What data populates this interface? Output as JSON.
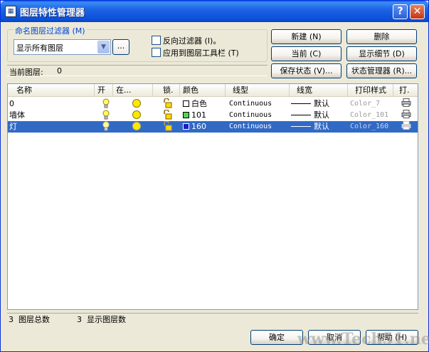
{
  "window": {
    "title": "图层特性管理器",
    "help_glyph": "?",
    "close_glyph": "✕"
  },
  "filter": {
    "group_label": "命名图层过滤器 (M)",
    "selected": "显示所有图层",
    "dots_label": "...",
    "invert_label": "反向过滤器 (I)。",
    "apply_toolbar_label": "应用到图层工具栏 (T)"
  },
  "buttons": {
    "new": "新建 (N)",
    "delete": "删除",
    "current": "当前 (C)",
    "details": "显示细节 (D)",
    "save_state": "保存状态 (V)...",
    "state_manager": "状态管理器 (R)...",
    "ok": "确定",
    "cancel": "取消",
    "help": "帮助 (H)"
  },
  "current_layer": {
    "label": "当前图层:",
    "value": "0"
  },
  "table": {
    "columns": [
      "名称",
      "开",
      "在...",
      "锁.",
      "颜色",
      "线型",
      "线宽",
      "打印样式",
      "打."
    ],
    "rows": [
      {
        "name": "0",
        "color_hex": "#ffffff",
        "color_label": "白色",
        "linetype": "Continuous",
        "lineweight": "默认",
        "plotstyle": "Color_7",
        "selected": false
      },
      {
        "name": "墙体",
        "color_hex": "#53d653",
        "color_label": "101",
        "linetype": "Continuous",
        "lineweight": "默认",
        "plotstyle": "Color_101",
        "selected": false
      },
      {
        "name": "灯",
        "color_hex": "#1a1ad0",
        "color_label": "160",
        "linetype": "Continuous",
        "lineweight": "默认",
        "plotstyle": "Color_160",
        "selected": true
      }
    ]
  },
  "status": {
    "total_count": "3",
    "total_label": "图层总数",
    "shown_count": "3",
    "shown_label": "显示图层数"
  },
  "watermark": "www.Tech51.net"
}
